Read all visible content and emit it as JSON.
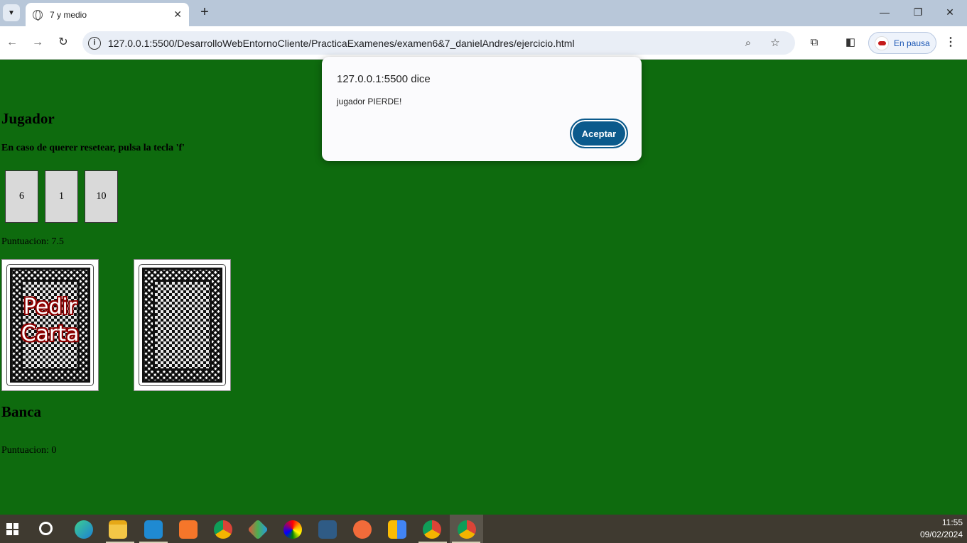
{
  "browser": {
    "tab_title": "7 y medio",
    "tab_close": "✕",
    "new_tab": "+",
    "url": "127.0.0.1:5500/DesarrolloWebEntornoCliente/PracticaExamenes/examen6&7_danielAndres/ejercicio.html",
    "profile_label": "En pausa",
    "controls": {
      "minimize": "—",
      "restore": "❐",
      "close": "✕"
    },
    "nav": {
      "back": "←",
      "forward": "→",
      "reload": "↻"
    },
    "menu": "⋮"
  },
  "game": {
    "player_heading": "Jugador",
    "reset_hint": "En caso de querer resetear, pulsa la tecla 'f'",
    "player_cards": [
      "6",
      "1",
      "10"
    ],
    "player_score": "Puntuacion: 7.5",
    "draw_button_label": "Pedir Carta",
    "bank_heading": "Banca",
    "bank_score": "Puntuacion: 0"
  },
  "dialog": {
    "title": "127.0.0.1:5500 dice",
    "message": "jugador PIERDE!",
    "ok_label": "Aceptar"
  },
  "taskbar": {
    "time": "11:55",
    "date": "09/02/2024",
    "apps": [
      "search-icon",
      "edge-icon",
      "file-explorer-icon",
      "vscode-icon",
      "xampp-icon",
      "chrome-icon",
      "git-icon",
      "color-app-icon",
      "mysql-workbench-icon",
      "postman-icon",
      "sourcetree-icon",
      "chrome-profile-d-icon",
      "chrome-active-icon"
    ]
  },
  "colors": {
    "page_background": "#0e6b0e",
    "dialog_button": "#0b5a8c",
    "pedir_outline": "#8b0000"
  }
}
